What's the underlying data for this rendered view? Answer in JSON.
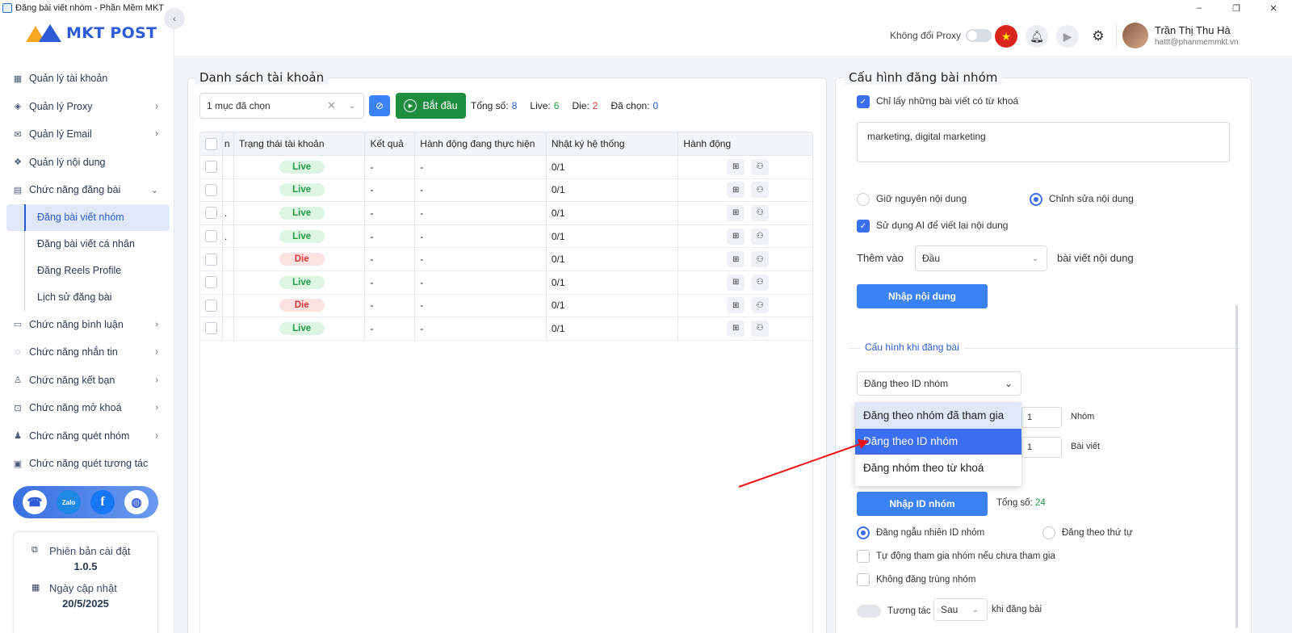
{
  "window": {
    "title": "Đăng bài viết nhóm - Phần Mềm MKT",
    "minimize": "–",
    "restore": "❐",
    "close": "✕"
  },
  "logo": {
    "text": "MKT POST"
  },
  "header": {
    "proxy_label": "Không đổi Proxy",
    "user_name": "Trần Thị Thu Hà",
    "user_email": "hattt@phanmemmkt.vn"
  },
  "sidebar": {
    "items": [
      {
        "label": "Quản lý tài khoản",
        "icon": "grid-icon",
        "glyph": "▦",
        "chevron": ""
      },
      {
        "label": "Quản lý Proxy",
        "icon": "layers-icon",
        "glyph": "◈",
        "chevron": "›"
      },
      {
        "label": "Quản lý Email",
        "icon": "mail-icon",
        "glyph": "✉",
        "chevron": "›"
      },
      {
        "label": "Quản lý nội dung",
        "icon": "content-icon",
        "glyph": "❖",
        "chevron": ""
      },
      {
        "label": "Chức năng đăng bài",
        "icon": "post-icon",
        "glyph": "▤",
        "chevron": "⌄"
      }
    ],
    "subitems": [
      {
        "label": "Đăng bài viết nhóm",
        "active": true
      },
      {
        "label": "Đăng bài viết cá nhân",
        "active": false
      },
      {
        "label": "Đăng Reels Profile",
        "active": false
      },
      {
        "label": "Lịch sử đăng bài",
        "active": false
      }
    ],
    "items2": [
      {
        "label": "Chức năng bình luận",
        "icon": "comment-icon",
        "glyph": "▭",
        "chevron": "›"
      },
      {
        "label": "Chức năng nhắn tin",
        "icon": "chat-icon",
        "glyph": "◌",
        "chevron": "›"
      },
      {
        "label": "Chức năng kết bạn",
        "icon": "add-friend-icon",
        "glyph": "♙",
        "chevron": "›"
      },
      {
        "label": "Chức năng mở khoá",
        "icon": "lock-icon",
        "glyph": "⊡",
        "chevron": "›"
      },
      {
        "label": "Chức năng quét nhóm",
        "icon": "group-icon",
        "glyph": "♟",
        "chevron": "›"
      },
      {
        "label": "Chức năng quét tương tác",
        "icon": "scan-icon",
        "glyph": "▣",
        "chevron": ""
      }
    ],
    "social": {
      "zalo": "Zalo"
    },
    "version_label": "Phiên bản cài đặt",
    "version_value": "1.0.5",
    "update_label": "Ngày cập nhật",
    "update_value": "20/5/2025"
  },
  "left_panel": {
    "title": "Danh sách tài khoản",
    "select_value": "1 mục đã chọn",
    "start_label": "Bắt đầu",
    "stats": {
      "total_label": "Tổng số:",
      "total": "8",
      "live_label": "Live:",
      "live": "6",
      "die_label": "Die:",
      "die": "2",
      "selected_label": "Đã chọn:",
      "selected": "0"
    },
    "columns": [
      "n",
      "Trạng thái tài khoản",
      "Kết quả",
      "Hành động đang thực hiện",
      "Nhật ký hệ thống",
      "Hành động"
    ],
    "rows": [
      {
        "c1": "",
        "status": "Live",
        "result": "-",
        "action": "-",
        "log": "0/1"
      },
      {
        "c1": "",
        "status": "Live",
        "result": "-",
        "action": "-",
        "log": "0/1"
      },
      {
        "c1": ".",
        "status": "Live",
        "result": "-",
        "action": "-",
        "log": "0/1"
      },
      {
        "c1": ".",
        "status": "Live",
        "result": "-",
        "action": "-",
        "log": "0/1"
      },
      {
        "c1": "",
        "status": "Die",
        "result": "-",
        "action": "-",
        "log": "0/1"
      },
      {
        "c1": "",
        "status": "Live",
        "result": "-",
        "action": "-",
        "log": "0/1"
      },
      {
        "c1": "",
        "status": "Die",
        "result": "-",
        "action": "-",
        "log": "0/1"
      },
      {
        "c1": "",
        "status": "Live",
        "result": "-",
        "action": "-",
        "log": "0/1"
      }
    ]
  },
  "right_panel": {
    "title": "Cấu hình đăng bài nhóm",
    "keyword_only": "Chỉ lấy những bài viết có từ khoá",
    "keywords": "marketing, digital marketing",
    "keep_content": "Giữ nguyên nội dung",
    "edit_content": "Chỉnh sửa nội dung",
    "use_ai": "Sử dụng AI để viết lại nội dung",
    "add_to": "Thêm vào",
    "add_pos": "Đầu",
    "add_suffix": "bài viết nội dung",
    "import_content": "Nhập nội dung",
    "section_title": "Cấu hình khi đăng bài",
    "mode_value": "Đăng theo ID nhóm",
    "mode_options": [
      "Đăng theo nhóm đã tham gia",
      "Đăng theo ID nhóm",
      "Đăng nhóm theo từ khoá"
    ],
    "group_count": "1",
    "group_unit": "Nhóm",
    "post_count": "1",
    "post_unit": "Bài viết",
    "import_group": "Nhập ID nhóm",
    "total_label": "Tổng số:",
    "total_value": "24",
    "random_id": "Đăng ngẫu nhiên ID nhóm",
    "ordered": "Đăng theo thứ tự",
    "auto_join": "Tự động tham gia nhóm nếu chưa tham gia",
    "no_dup": "Không đăng trùng nhóm",
    "interact": "Tương tác",
    "interact_when": "Sau",
    "interact_suffix": "khi đăng bài"
  }
}
